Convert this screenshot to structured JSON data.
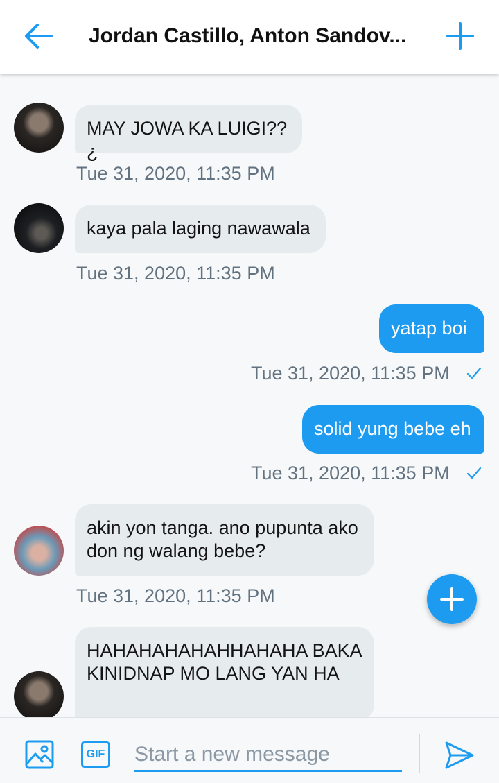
{
  "header": {
    "title": "Jordan Castillo, Anton Sandov...",
    "back_icon": "arrow-left-icon",
    "add_icon": "plus-icon",
    "accent": "#1d9bf0"
  },
  "messages": [
    {
      "direction": "incoming",
      "avatar": "avatar-dark-portrait",
      "text": "MAY JOWA KA LUIGI??¿",
      "timestamp": "Tue 31, 2020, 11:35 PM"
    },
    {
      "direction": "incoming",
      "avatar": "avatar-night-street",
      "text": "kaya pala laging nawawala",
      "timestamp": "Tue 31, 2020, 11:35 PM"
    },
    {
      "direction": "outgoing",
      "text": "yatap boi",
      "timestamp": "Tue 31, 2020, 11:35 PM",
      "status_icon": "check-icon"
    },
    {
      "direction": "outgoing",
      "text": "solid yung bebe eh",
      "timestamp": "Tue 31, 2020, 11:35 PM",
      "status_icon": "check-icon"
    },
    {
      "direction": "incoming",
      "avatar": "avatar-beach",
      "text": "akin yon tanga. ano pupunta ako don ng walang bebe?",
      "timestamp": "Tue 31, 2020, 11:35 PM"
    },
    {
      "direction": "incoming",
      "avatar": "avatar-dark-portrait",
      "text": "HAHAHAHAHAHHAHAHA BAKA KINIDNAP MO LANG YAN HA",
      "timestamp": ""
    }
  ],
  "fab": {
    "icon": "plus-icon"
  },
  "composer": {
    "image_icon": "image-icon",
    "gif_label": "GIF",
    "placeholder": "Start a new message",
    "value": "",
    "send_icon": "send-icon"
  },
  "colors": {
    "accent": "#1d9bf0",
    "incoming_bubble": "#e6ebee",
    "timestamp": "#627280",
    "background": "#f6f8f9"
  }
}
